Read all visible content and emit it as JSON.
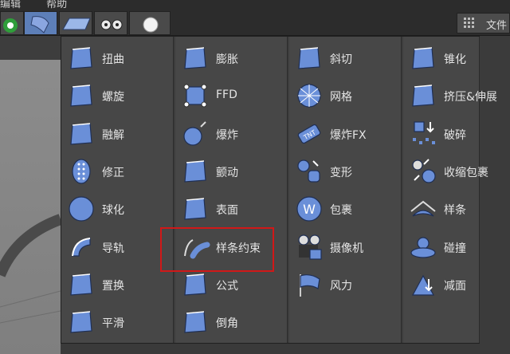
{
  "top_menu": [
    "编辑",
    "帮助"
  ],
  "file_label": "文件",
  "colors": {
    "highlight": "#d11818",
    "icon_fill": "#6a8fd8",
    "menu_bg": "#474747"
  },
  "columns": [
    [
      {
        "label": "扭曲",
        "icon": "bend-icon"
      },
      {
        "label": "螺旋",
        "icon": "twist-icon"
      },
      {
        "label": "融解",
        "icon": "melt-icon"
      },
      {
        "label": "修正",
        "icon": "correction-icon"
      },
      {
        "label": "球化",
        "icon": "spherify-icon"
      },
      {
        "label": "导轨",
        "icon": "rail-icon"
      },
      {
        "label": "置换",
        "icon": "displacer-icon"
      },
      {
        "label": "平滑",
        "icon": "smoothing-icon"
      }
    ],
    [
      {
        "label": "膨胀",
        "icon": "bulge-icon"
      },
      {
        "label": "FFD",
        "icon": "ffd-icon"
      },
      {
        "label": "爆炸",
        "icon": "explosion-icon"
      },
      {
        "label": "颤动",
        "icon": "jiggle-icon"
      },
      {
        "label": "表面",
        "icon": "surface-icon"
      },
      {
        "label": "样条约束",
        "icon": "spline-wrap-icon"
      },
      {
        "label": "公式",
        "icon": "formula-icon"
      },
      {
        "label": "倒角",
        "icon": "bevel-icon"
      }
    ],
    [
      {
        "label": "斜切",
        "icon": "shear-icon"
      },
      {
        "label": "网格",
        "icon": "mesh-icon"
      },
      {
        "label": "爆炸FX",
        "icon": "explosion-fx-icon"
      },
      {
        "label": "变形",
        "icon": "morph-icon"
      },
      {
        "label": "包裹",
        "icon": "wrap-icon"
      },
      {
        "label": "摄像机",
        "icon": "camera-icon"
      },
      {
        "label": "风力",
        "icon": "wind-icon"
      }
    ],
    [
      {
        "label": "锥化",
        "icon": "taper-icon"
      },
      {
        "label": "挤压&伸展",
        "icon": "squash-stretch-icon"
      },
      {
        "label": "破碎",
        "icon": "shatter-icon"
      },
      {
        "label": "收缩包裹",
        "icon": "shrink-wrap-icon"
      },
      {
        "label": "样条",
        "icon": "spline-icon"
      },
      {
        "label": "碰撞",
        "icon": "collision-icon"
      },
      {
        "label": "减面",
        "icon": "polygon-reduction-icon"
      }
    ]
  ]
}
